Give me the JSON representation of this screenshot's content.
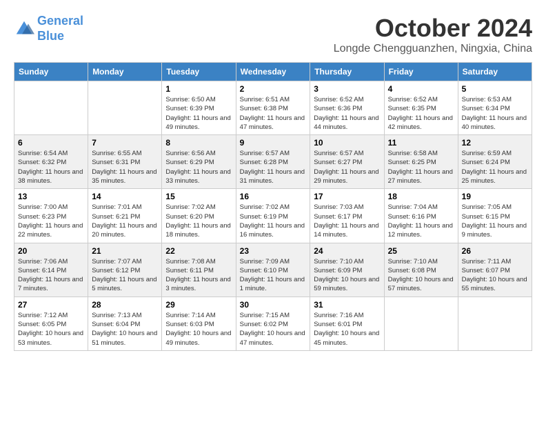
{
  "header": {
    "logo_line1": "General",
    "logo_line2": "Blue",
    "month": "October 2024",
    "location": "Longde Chengguanzhen, Ningxia, China"
  },
  "weekdays": [
    "Sunday",
    "Monday",
    "Tuesday",
    "Wednesday",
    "Thursday",
    "Friday",
    "Saturday"
  ],
  "weeks": [
    [
      {
        "day": "",
        "info": ""
      },
      {
        "day": "",
        "info": ""
      },
      {
        "day": "1",
        "info": "Sunrise: 6:50 AM\nSunset: 6:39 PM\nDaylight: 11 hours and 49 minutes."
      },
      {
        "day": "2",
        "info": "Sunrise: 6:51 AM\nSunset: 6:38 PM\nDaylight: 11 hours and 47 minutes."
      },
      {
        "day": "3",
        "info": "Sunrise: 6:52 AM\nSunset: 6:36 PM\nDaylight: 11 hours and 44 minutes."
      },
      {
        "day": "4",
        "info": "Sunrise: 6:52 AM\nSunset: 6:35 PM\nDaylight: 11 hours and 42 minutes."
      },
      {
        "day": "5",
        "info": "Sunrise: 6:53 AM\nSunset: 6:34 PM\nDaylight: 11 hours and 40 minutes."
      }
    ],
    [
      {
        "day": "6",
        "info": "Sunrise: 6:54 AM\nSunset: 6:32 PM\nDaylight: 11 hours and 38 minutes."
      },
      {
        "day": "7",
        "info": "Sunrise: 6:55 AM\nSunset: 6:31 PM\nDaylight: 11 hours and 35 minutes."
      },
      {
        "day": "8",
        "info": "Sunrise: 6:56 AM\nSunset: 6:29 PM\nDaylight: 11 hours and 33 minutes."
      },
      {
        "day": "9",
        "info": "Sunrise: 6:57 AM\nSunset: 6:28 PM\nDaylight: 11 hours and 31 minutes."
      },
      {
        "day": "10",
        "info": "Sunrise: 6:57 AM\nSunset: 6:27 PM\nDaylight: 11 hours and 29 minutes."
      },
      {
        "day": "11",
        "info": "Sunrise: 6:58 AM\nSunset: 6:25 PM\nDaylight: 11 hours and 27 minutes."
      },
      {
        "day": "12",
        "info": "Sunrise: 6:59 AM\nSunset: 6:24 PM\nDaylight: 11 hours and 25 minutes."
      }
    ],
    [
      {
        "day": "13",
        "info": "Sunrise: 7:00 AM\nSunset: 6:23 PM\nDaylight: 11 hours and 22 minutes."
      },
      {
        "day": "14",
        "info": "Sunrise: 7:01 AM\nSunset: 6:21 PM\nDaylight: 11 hours and 20 minutes."
      },
      {
        "day": "15",
        "info": "Sunrise: 7:02 AM\nSunset: 6:20 PM\nDaylight: 11 hours and 18 minutes."
      },
      {
        "day": "16",
        "info": "Sunrise: 7:02 AM\nSunset: 6:19 PM\nDaylight: 11 hours and 16 minutes."
      },
      {
        "day": "17",
        "info": "Sunrise: 7:03 AM\nSunset: 6:17 PM\nDaylight: 11 hours and 14 minutes."
      },
      {
        "day": "18",
        "info": "Sunrise: 7:04 AM\nSunset: 6:16 PM\nDaylight: 11 hours and 12 minutes."
      },
      {
        "day": "19",
        "info": "Sunrise: 7:05 AM\nSunset: 6:15 PM\nDaylight: 11 hours and 9 minutes."
      }
    ],
    [
      {
        "day": "20",
        "info": "Sunrise: 7:06 AM\nSunset: 6:14 PM\nDaylight: 11 hours and 7 minutes."
      },
      {
        "day": "21",
        "info": "Sunrise: 7:07 AM\nSunset: 6:12 PM\nDaylight: 11 hours and 5 minutes."
      },
      {
        "day": "22",
        "info": "Sunrise: 7:08 AM\nSunset: 6:11 PM\nDaylight: 11 hours and 3 minutes."
      },
      {
        "day": "23",
        "info": "Sunrise: 7:09 AM\nSunset: 6:10 PM\nDaylight: 11 hours and 1 minute."
      },
      {
        "day": "24",
        "info": "Sunrise: 7:10 AM\nSunset: 6:09 PM\nDaylight: 10 hours and 59 minutes."
      },
      {
        "day": "25",
        "info": "Sunrise: 7:10 AM\nSunset: 6:08 PM\nDaylight: 10 hours and 57 minutes."
      },
      {
        "day": "26",
        "info": "Sunrise: 7:11 AM\nSunset: 6:07 PM\nDaylight: 10 hours and 55 minutes."
      }
    ],
    [
      {
        "day": "27",
        "info": "Sunrise: 7:12 AM\nSunset: 6:05 PM\nDaylight: 10 hours and 53 minutes."
      },
      {
        "day": "28",
        "info": "Sunrise: 7:13 AM\nSunset: 6:04 PM\nDaylight: 10 hours and 51 minutes."
      },
      {
        "day": "29",
        "info": "Sunrise: 7:14 AM\nSunset: 6:03 PM\nDaylight: 10 hours and 49 minutes."
      },
      {
        "day": "30",
        "info": "Sunrise: 7:15 AM\nSunset: 6:02 PM\nDaylight: 10 hours and 47 minutes."
      },
      {
        "day": "31",
        "info": "Sunrise: 7:16 AM\nSunset: 6:01 PM\nDaylight: 10 hours and 45 minutes."
      },
      {
        "day": "",
        "info": ""
      },
      {
        "day": "",
        "info": ""
      }
    ]
  ]
}
